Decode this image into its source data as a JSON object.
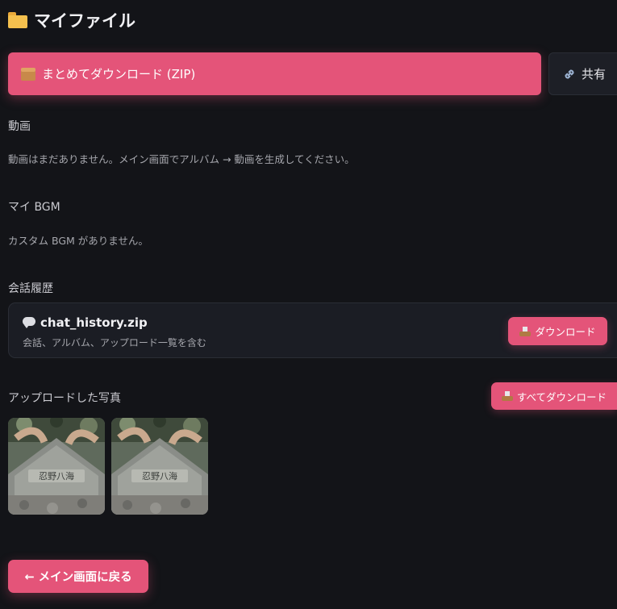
{
  "page": {
    "title": "マイファイル",
    "title_icon": "folder-icon"
  },
  "toolbar": {
    "zip_download_label": "まとめてダウンロード (ZIP)",
    "zip_download_icon": "package-icon",
    "share_label": "共有",
    "share_icon": "link-icon",
    "accent_color": "#e45479"
  },
  "videos": {
    "heading": "動画",
    "empty_message": "動画はまだありません。メイン画面でアルバム → 動画を生成してください。"
  },
  "bgm": {
    "heading": "マイ BGM",
    "empty_message": "カスタム BGM がありません。"
  },
  "history": {
    "heading": "会話履歴",
    "file_name": "chat_history.zip",
    "file_icon": "speech-bubble-icon",
    "description": "会話、アルバム、アップロード一覧を含む",
    "download_label": "ダウンロード",
    "download_icon": "inbox-tray-icon"
  },
  "photos": {
    "heading": "アップロードした写真",
    "download_all_label": "すべてダウンロード",
    "download_all_icon": "inbox-tray-icon",
    "items": [
      {
        "caption_text": "忍野八海"
      },
      {
        "caption_text": "忍野八海"
      }
    ]
  },
  "footer": {
    "back_label": "← メイン画面に戻る"
  }
}
